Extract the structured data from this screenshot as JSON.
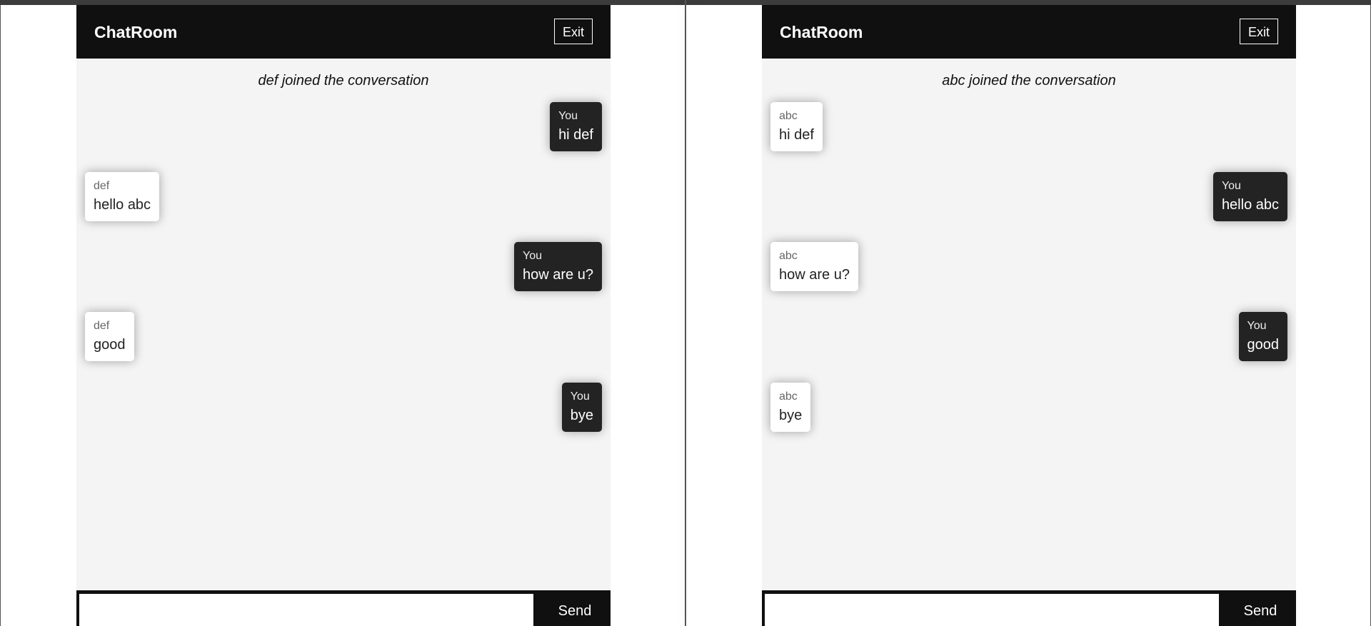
{
  "left": {
    "brand": "ChatRoom",
    "exit_label": "Exit",
    "notice": "def joined the conversation",
    "messages": [
      {
        "sender": "You",
        "text": "hi def",
        "side": "out"
      },
      {
        "sender": "def",
        "text": "hello abc",
        "side": "in"
      },
      {
        "sender": "You",
        "text": "how are u?",
        "side": "out"
      },
      {
        "sender": "def",
        "text": "good",
        "side": "in"
      },
      {
        "sender": "You",
        "text": "bye",
        "side": "out"
      }
    ],
    "input_value": "",
    "send_label": "Send"
  },
  "right": {
    "brand": "ChatRoom",
    "exit_label": "Exit",
    "notice": "abc joined the conversation",
    "messages": [
      {
        "sender": "abc",
        "text": "hi def",
        "side": "in"
      },
      {
        "sender": "You",
        "text": "hello abc",
        "side": "out"
      },
      {
        "sender": "abc",
        "text": "how are u?",
        "side": "in"
      },
      {
        "sender": "You",
        "text": "good",
        "side": "out"
      },
      {
        "sender": "abc",
        "text": "bye",
        "side": "in"
      }
    ],
    "input_value": "",
    "send_label": "Send"
  },
  "colors": {
    "header_bg": "#101010",
    "chat_bg": "#f4f4f4",
    "incoming_bubble": "#ffffff",
    "outgoing_bubble": "#232323"
  }
}
